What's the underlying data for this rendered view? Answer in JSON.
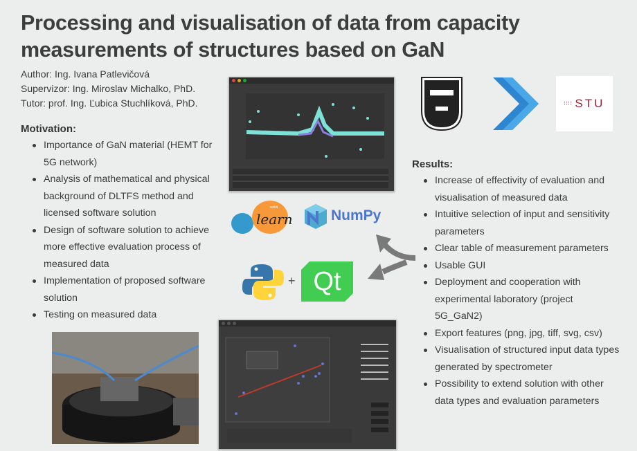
{
  "title": "Processing and visualisation of data from capacity measurements of structures based on GaN",
  "author": "Author: Ing. Ivana Patlevičová",
  "supervisor": "Supervizor: Ing. Miroslav Michalko, PhD.",
  "tutor": "Tutor: prof. Ing. Ľubica Stuchlíková, PhD.",
  "motivation": {
    "heading": "Motivation:",
    "items": [
      "Importance of GaN material (HEMT for 5G network)",
      "Analysis of mathematical and physical background of DLTFS method and licensed software solution",
      "Design of software solution to achieve more effective evaluation process of measured data",
      "Implementation of proposed software solution",
      "Testing on measured data"
    ]
  },
  "results": {
    "heading": "Results:",
    "items": [
      "Increase of effectivity of evaluation and visualisation of measured data",
      "Intuitive selection of input and sensitivity parameters",
      "Clear table of measurement parameters",
      "Usable GUI",
      "Deployment and cooperation with experimental laboratory (project 5G_GaN2)",
      "Export features (png, jpg, tiff, svg, csv)",
      "Visualisation of structured input data types generated by spectrometer",
      "Possibility to extend solution with other data types and evaluation parameters"
    ]
  },
  "logos": {
    "stu": "STU",
    "sklearn": "learn",
    "sklearn_small": "scikit",
    "numpy": "NumPy",
    "qt": "Qt",
    "plus": "+"
  },
  "colors": {
    "stu_red": "#9b2335",
    "chevron_blue": "#2f86d0",
    "numpy_blue": "#4d77cf",
    "qt_green": "#41cd52",
    "sk_orange": "#f89939",
    "sk_blue": "#3499cd",
    "python_blue": "#3776ab",
    "python_yellow": "#ffd43b",
    "arrow_gray": "#7a7a7a"
  }
}
